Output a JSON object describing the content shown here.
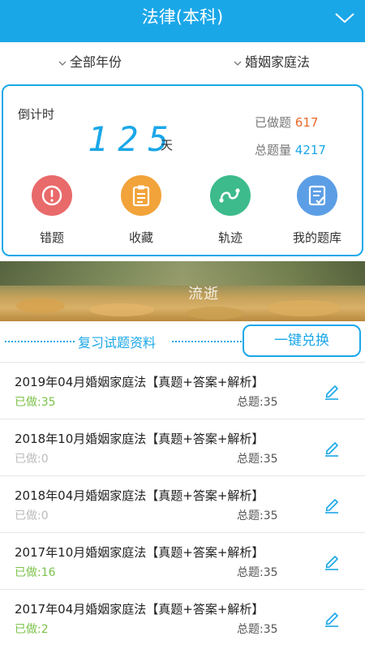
{
  "header": {
    "title": "法律(本科)"
  },
  "filters": {
    "year": "全部年份",
    "subject": "婚姻家庭法"
  },
  "countdown": {
    "label": "倒计时",
    "value": "125",
    "unit": "天"
  },
  "stats": {
    "done_label": "已做题",
    "done_value": "617",
    "total_label": "总题量",
    "total_value": "4217"
  },
  "shortcuts": [
    {
      "label": "错题",
      "color": "#e96a6a",
      "icon": "exclamation-icon"
    },
    {
      "label": "收藏",
      "color": "#f2a33a",
      "icon": "clipboard-icon"
    },
    {
      "label": "轨迹",
      "color": "#3dbb8d",
      "icon": "track-icon"
    },
    {
      "label": "我的题库",
      "color": "#5c9ee6",
      "icon": "question-bank-icon"
    }
  ],
  "banner": {
    "text": "流逝"
  },
  "section": {
    "title": "复习试题资料",
    "exchange_label": "一键兑换"
  },
  "papers": [
    {
      "title": "2019年04月婚姻家庭法【真题+答案+解析】",
      "done": "已做:35",
      "total": "总题:35"
    },
    {
      "title": "2018年10月婚姻家庭法【真题+答案+解析】",
      "done": "已做:0",
      "total": "总题:35"
    },
    {
      "title": "2018年04月婚姻家庭法【真题+答案+解析】",
      "done": "已做:0",
      "total": "总题:35"
    },
    {
      "title": "2017年10月婚姻家庭法【真题+答案+解析】",
      "done": "已做:16",
      "total": "总题:35"
    },
    {
      "title": "2017年04月婚姻家庭法【真题+答案+解析】",
      "done": "已做:2",
      "total": "总题:35"
    }
  ],
  "colors": {
    "accent": "#1aa7e8",
    "done_active": "#7cc24a",
    "done_zero": "#bbbbbb"
  }
}
